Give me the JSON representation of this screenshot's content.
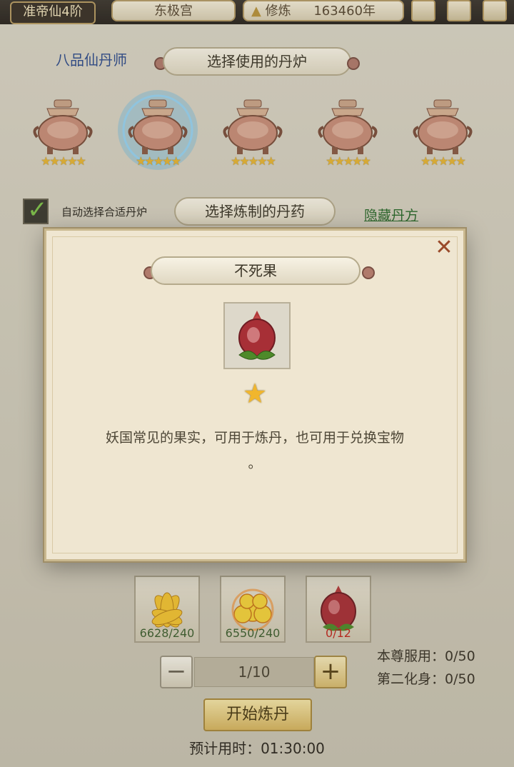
{
  "topbar": {
    "rank": "准帝仙4阶",
    "location": "东极宫",
    "mode_label": "修炼",
    "years": "163460年"
  },
  "alchemist": {
    "title": "八品仙丹师",
    "choose_furnace": "选择使用的丹炉"
  },
  "furnaces": [
    {
      "name": "furnace-1",
      "stars": "★★★★★",
      "selected": false
    },
    {
      "name": "furnace-2",
      "stars": "★★★★★",
      "selected": true
    },
    {
      "name": "furnace-3",
      "stars": "★★★★★",
      "selected": false
    },
    {
      "name": "furnace-4",
      "stars": "★★★★★",
      "selected": false
    },
    {
      "name": "furnace-5",
      "stars": "★★★★★",
      "selected": false
    }
  ],
  "auto_select": {
    "label": "自动选择合适丹炉",
    "checked": true
  },
  "choose_pill": "选择炼制的丹药",
  "hidden_recipe": "隐藏丹方",
  "materials": [
    {
      "icon": "golden-flower-icon",
      "count": "6628/240",
      "count_color": "#3f5f2f"
    },
    {
      "icon": "golden-cloud-flower-icon",
      "count": "6550/240",
      "count_color": "#3f5f2f"
    },
    {
      "icon": "immortal-fruit-icon",
      "count": "0/12",
      "count_color": "#c0271e"
    }
  ],
  "usage": {
    "self": "本尊服用：0/50",
    "second": "第二化身：0/50"
  },
  "quantity": {
    "minus": "−",
    "value": "1/10",
    "plus": "+"
  },
  "start_button": "开始炼丹",
  "eta": "预计用时：01:30:00",
  "modal": {
    "title": "不死果",
    "close": "✕",
    "stars": "★",
    "description_line1": "妖国常见的果实，可用于炼丹，也可用于兑换宝物",
    "description_line2": "。",
    "accent_color": "#c27a5a"
  }
}
